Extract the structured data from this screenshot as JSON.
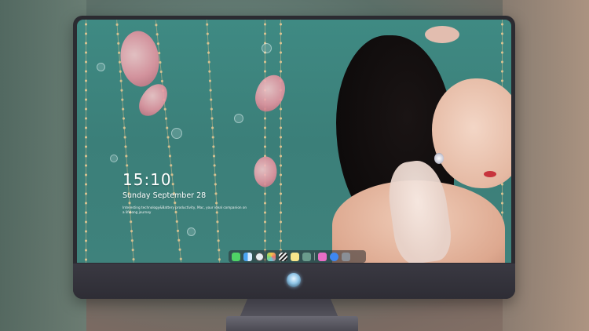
{
  "lock_screen": {
    "time": "15:10",
    "date": "Sunday September 28",
    "tagline": "Interesting technology&Battery productivity, Mac, your ideal companion on a lifelong journey"
  },
  "dock": {
    "apps": [
      {
        "icon": "messages-icon",
        "color": "#4fd266"
      },
      {
        "icon": "finder-icon",
        "color": "#4aa3f0"
      },
      {
        "icon": "safari-icon",
        "color": "#e8eef2"
      },
      {
        "icon": "photos-icon",
        "color": "#f3c64a"
      },
      {
        "icon": "clapper-icon",
        "color": "#3f5fb0"
      },
      {
        "icon": "notes-icon",
        "color": "#f7e58b"
      },
      {
        "icon": "app-store-icon",
        "color": "#6ac0d8"
      },
      {
        "icon": "music-icon",
        "color": "#e86ec5"
      },
      {
        "icon": "safari-compass-icon",
        "color": "#3e87f0"
      },
      {
        "icon": "camera-icon",
        "color": "#8a8f96"
      }
    ]
  },
  "colors": {
    "wallpaper_teal": "#3f8a83",
    "bezel": "#2b2b31",
    "chin": "#34333b"
  }
}
